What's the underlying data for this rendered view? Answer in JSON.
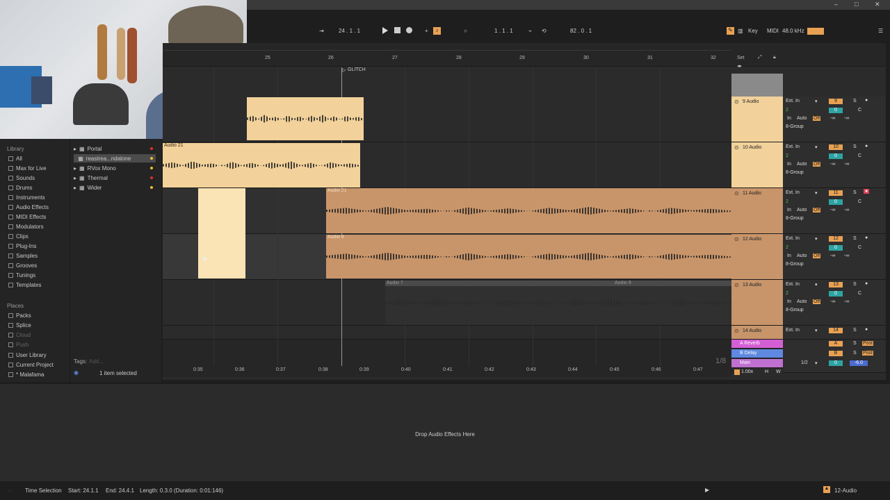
{
  "titlebar": {
    "minimize": "–",
    "maximize": "□",
    "close": "✕"
  },
  "control_bar": {
    "position": "24 . 1 . 1",
    "loop_start": "1 . 1 . 1",
    "loop_length": "82 . 0 . 1",
    "key_label": "Key",
    "midi_label": "MIDI",
    "sample_rate": "48.0 kHz"
  },
  "library": {
    "header": "Library",
    "items": [
      "All",
      "Max for Live",
      "Sounds",
      "Drums",
      "Instruments",
      "Audio Effects",
      "MIDI Effects",
      "Modulators",
      "Clips",
      "Plug-Ins",
      "Samples",
      "Grooves",
      "Tunings",
      "Templates"
    ],
    "places_header": "Places",
    "places": [
      "Packs",
      "Splice",
      "Cloud",
      "Push",
      "User Library",
      "Current Project",
      "* Malafama"
    ]
  },
  "browser_list": {
    "items": [
      {
        "label": "Portal",
        "dot": "#e03030",
        "selected": false
      },
      {
        "label": "reastrea...ndalone",
        "dot": "#e8c030",
        "selected": true
      },
      {
        "label": "RVox Mono",
        "dot": "#e8c030",
        "selected": false
      },
      {
        "label": "Thermal",
        "dot": "#e03030",
        "selected": false
      },
      {
        "label": "Wider",
        "dot": "#e8c030",
        "selected": false
      }
    ],
    "tags_label": "Tags:",
    "tags_placeholder": "Add...",
    "selection_text": "1 item selected"
  },
  "ruler": {
    "bars": [
      "25",
      "26",
      "27",
      "28",
      "29",
      "30",
      "31",
      "32"
    ],
    "set_label": "Set",
    "locator": "GLITCH",
    "time_marks": [
      "0:35",
      "0:36",
      "0:37",
      "0:38",
      "0:39",
      "0:40",
      "0:41",
      "0:42",
      "0:43",
      "0:44",
      "0:45",
      "0:46",
      "0:47"
    ],
    "grid": "1/8"
  },
  "clips": {
    "audio21_a": "Audio 21",
    "audio21_b": "Audio 21",
    "audio8": "Audio 8",
    "audio7": "Audio 7",
    "audio9": "Audio 9"
  },
  "tracks": [
    {
      "name": "9 Audio",
      "input": "Ext. In",
      "ch": "2",
      "num": "9",
      "armed": false
    },
    {
      "name": "10 Audio",
      "input": "Ext. In",
      "ch": "2",
      "num": "10",
      "armed": false
    },
    {
      "name": "11 Audio",
      "input": "Ext. In",
      "ch": "2",
      "num": "11",
      "armed": true
    },
    {
      "name": "12 Audio",
      "input": "Ext. In",
      "ch": "2",
      "num": "12",
      "armed": false
    },
    {
      "name": "13 Audio",
      "input": "Ext. In",
      "ch": "2",
      "num": "13",
      "armed": false
    },
    {
      "name": "14 Audio",
      "input": "Ext. In",
      "ch": "2",
      "num": "14",
      "armed": false
    }
  ],
  "mixer_labels": {
    "in": "In",
    "auto": "Auto",
    "off": "Off",
    "group": "8-Group",
    "s": "S",
    "c": "C",
    "zero": "0",
    "neg_inf": "-∞"
  },
  "returns": [
    {
      "name": "A Reverb",
      "letter": "A",
      "color": "#d45fd4",
      "post": "Post"
    },
    {
      "name": "B Delay",
      "letter": "B",
      "color": "#5f88e0",
      "post": "Post"
    },
    {
      "name": "Main",
      "letter": "",
      "color": "#c070d0",
      "post": ""
    }
  ],
  "main_section": {
    "ratio": "1/2",
    "zero": "0",
    "level": "-6.0",
    "zoom": "1.00x",
    "h": "H",
    "w": "W"
  },
  "devices": {
    "drop_text": "Drop Audio Effects Here"
  },
  "status": {
    "mode": "Time Selection",
    "start": "Start: 24.1.1",
    "end": "End: 24.4.1",
    "length": "Length: 0.3.0 (Duration: 0:01:146)",
    "track": "12-Audio"
  }
}
